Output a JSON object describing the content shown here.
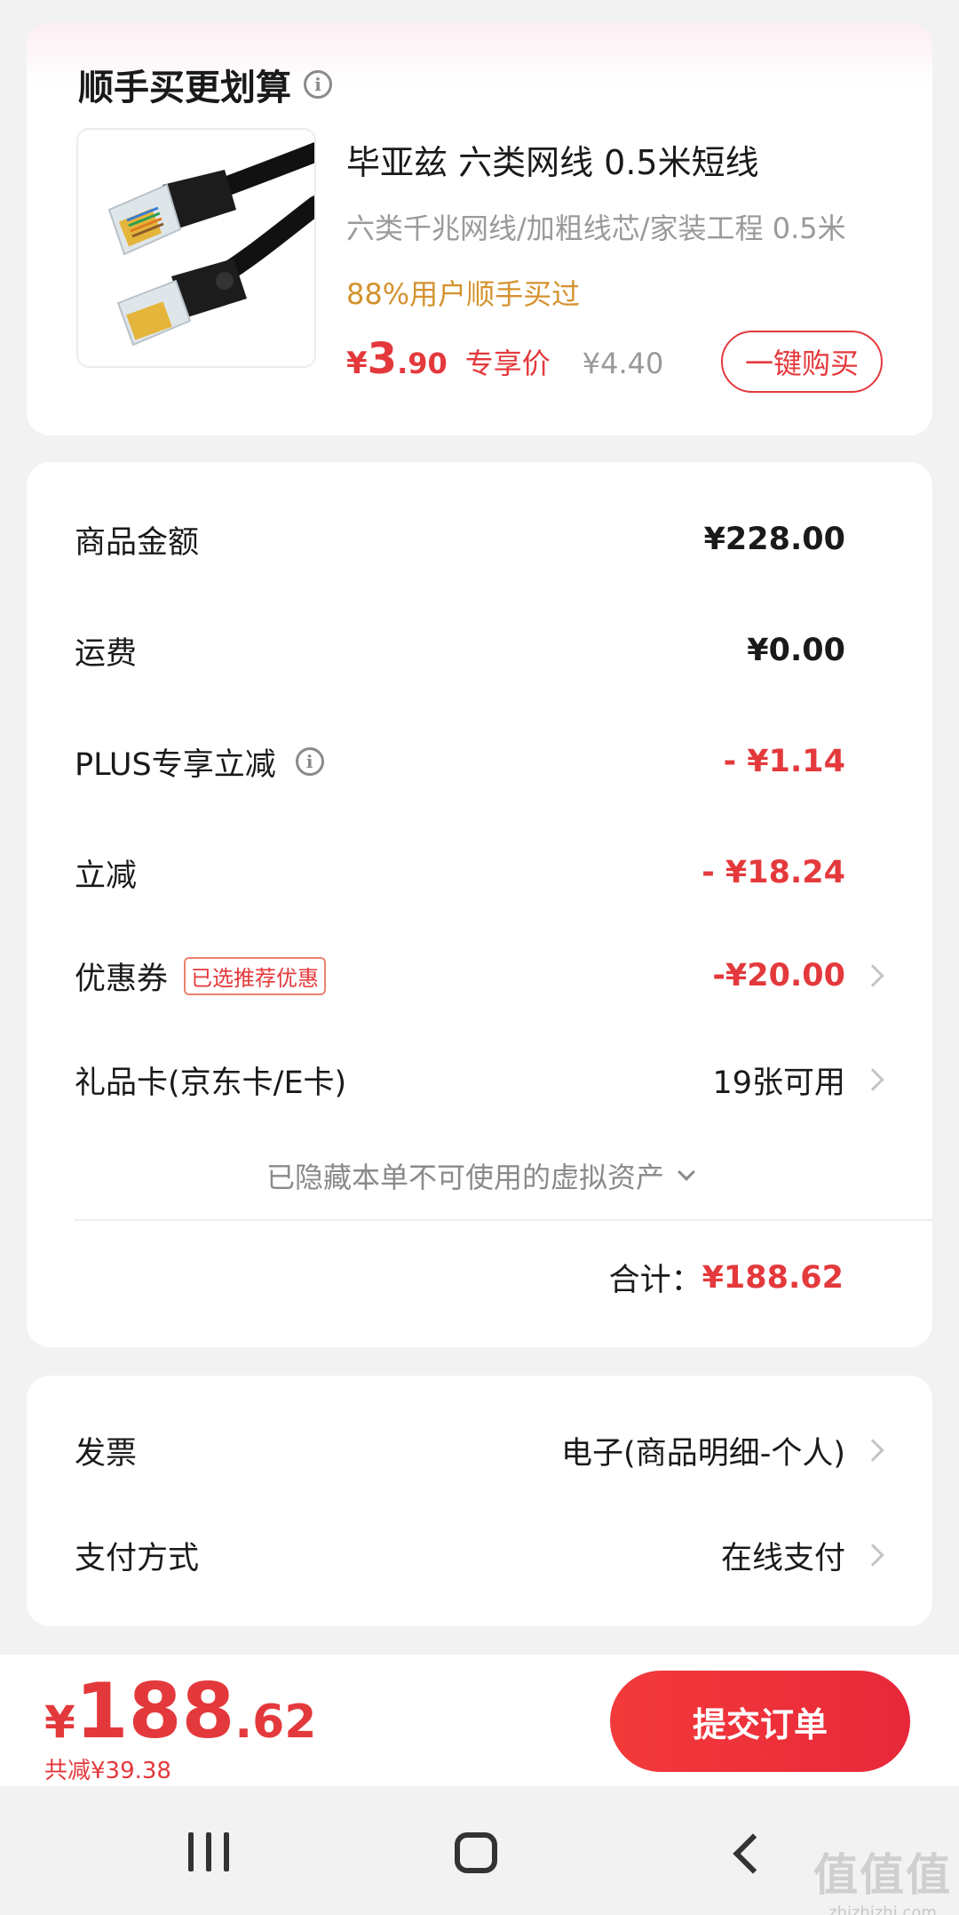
{
  "addon": {
    "title": "顺手买更划算",
    "product_name": "毕亚兹 六类网线 0.5米短线",
    "product_desc": "六类千兆网线/加粗线芯/家装工程   0.5米",
    "bought_text": "88%用户顺手买过",
    "price_currency": "¥",
    "price_int": "3",
    "price_dec": ".90",
    "price_tag": "专享价",
    "original_price": "¥4.40",
    "buy_button": "一键购买"
  },
  "summary": {
    "goods_label": "商品金额",
    "goods_value": "¥228.00",
    "shipping_label": "运费",
    "shipping_value": "¥0.00",
    "plus_label": "PLUS专享立减",
    "plus_value": "- ¥1.14",
    "discount_label": "立减",
    "discount_value": "- ¥18.24",
    "coupon_label": "优惠券",
    "coupon_badge": "已选推荐优惠",
    "coupon_value": "-¥20.00",
    "giftcard_label": "礼品卡(京东卡/E卡)",
    "giftcard_value": "19张可用",
    "hidden_note": "已隐藏本单不可使用的虚拟资产",
    "total_label": "合计：",
    "total_value": "¥188.62"
  },
  "invoice": {
    "invoice_label": "发票",
    "invoice_value": "电子(商品明细-个人)",
    "payment_label": "支付方式",
    "payment_value": "在线支付"
  },
  "bottom": {
    "currency": "¥",
    "price_int": "188",
    "price_dec": ".62",
    "saved_text": "共减¥39.38",
    "submit_button": "提交订单"
  },
  "watermark": {
    "big": "值值值",
    "small": "zhizhizhi.com"
  },
  "colors": {
    "accent_red": "#e4393c",
    "bought_orange": "#d4922e",
    "background": "#f2f2f2"
  },
  "icons": [
    "info-icon",
    "chevron-right-icon",
    "chevron-down-icon",
    "recents-icon",
    "home-icon",
    "back-icon"
  ]
}
